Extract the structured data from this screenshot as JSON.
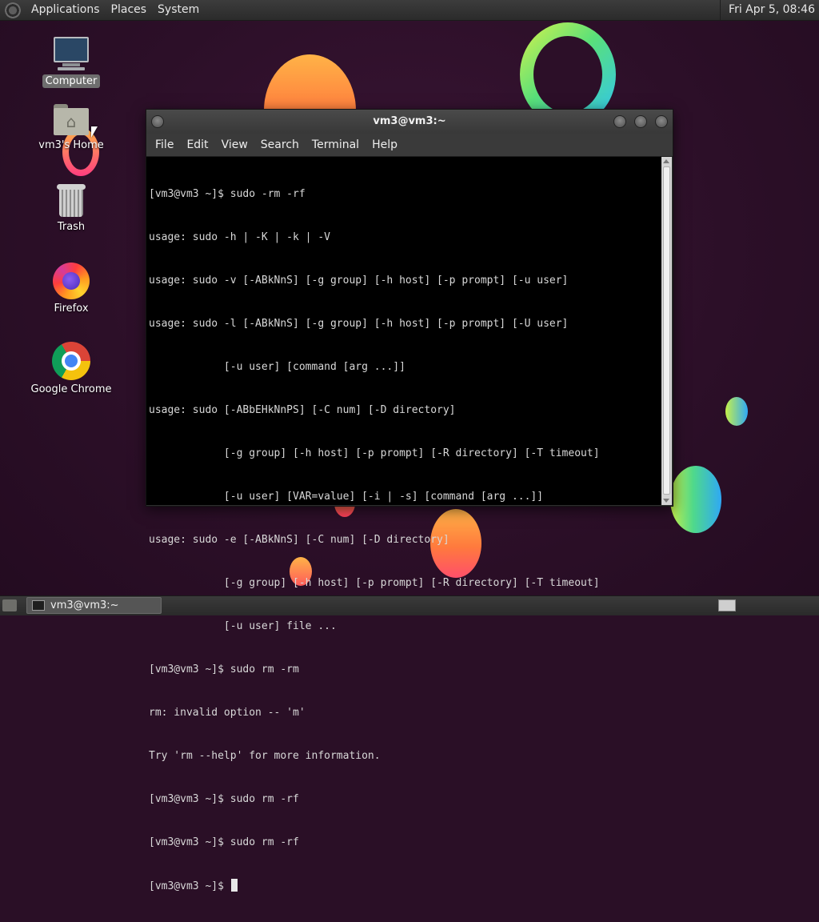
{
  "top_panel": {
    "menus": [
      "Applications",
      "Places",
      "System"
    ],
    "clock": "Fri Apr 5, 08:46"
  },
  "desktop_icons": [
    {
      "label": "Computer",
      "icon": "computer-icon",
      "selected": true
    },
    {
      "label": "vm3's Home",
      "icon": "home-folder-icon",
      "selected": false
    },
    {
      "label": "Trash",
      "icon": "trash-icon",
      "selected": false
    },
    {
      "label": "Firefox",
      "icon": "firefox-icon",
      "selected": false
    },
    {
      "label": "Google Chrome",
      "icon": "chrome-icon",
      "selected": false
    }
  ],
  "terminal_window": {
    "title": "vm3@vm3:~",
    "menu": [
      "File",
      "Edit",
      "View",
      "Search",
      "Terminal",
      "Help"
    ],
    "lines": [
      "[vm3@vm3 ~]$ sudo -rm -rf",
      "usage: sudo -h | -K | -k | -V",
      "usage: sudo -v [-ABkNnS] [-g group] [-h host] [-p prompt] [-u user]",
      "usage: sudo -l [-ABkNnS] [-g group] [-h host] [-p prompt] [-U user]",
      "            [-u user] [command [arg ...]]",
      "usage: sudo [-ABbEHkNnPS] [-C num] [-D directory]",
      "            [-g group] [-h host] [-p prompt] [-R directory] [-T timeout]",
      "            [-u user] [VAR=value] [-i | -s] [command [arg ...]]",
      "usage: sudo -e [-ABkNnS] [-C num] [-D directory]",
      "            [-g group] [-h host] [-p prompt] [-R directory] [-T timeout]",
      "            [-u user] file ...",
      "[vm3@vm3 ~]$ sudo rm -rm",
      "rm: invalid option -- 'm'",
      "Try 'rm --help' for more information.",
      "[vm3@vm3 ~]$ sudo rm -rf",
      "[vm3@vm3 ~]$ sudo rm -rf"
    ],
    "prompt": "[vm3@vm3 ~]$ "
  },
  "bottom_panel": {
    "task_label": "vm3@vm3:~"
  },
  "colors": {
    "wallpaper": "#2c0f28",
    "panel": "#333333",
    "terminal_bg": "#000000",
    "terminal_fg": "#d8d8d8"
  }
}
